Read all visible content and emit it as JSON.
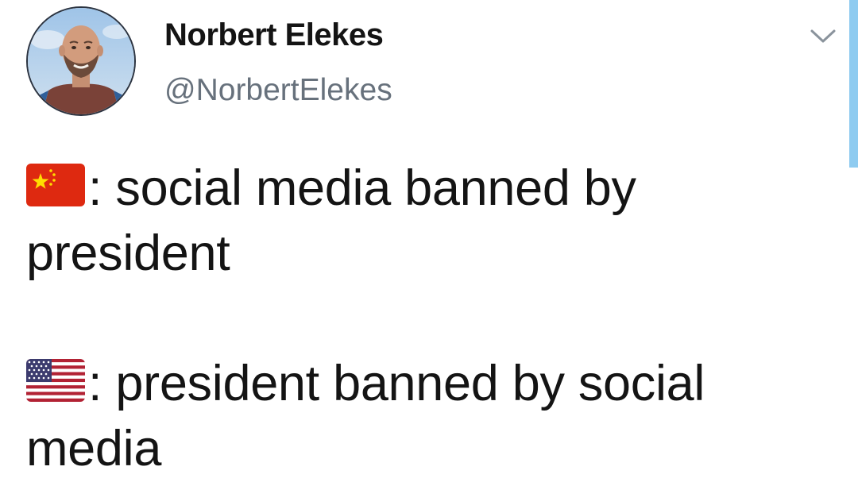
{
  "tweet": {
    "author": {
      "display_name": "Norbert Elekes",
      "handle": "@NorbertElekes",
      "avatar_icon": "profile-photo"
    },
    "menu_icon": "chevron-down-icon",
    "body": [
      {
        "flag_icon": "china-flag-icon",
        "text_part1": ": social media banned by",
        "text_part2": "president"
      },
      {
        "flag_icon": "us-flag-icon",
        "text_part1": ": president banned by social",
        "text_part2": "media"
      }
    ]
  },
  "colors": {
    "text": "#141414",
    "handle": "#67717c",
    "china_red": "#de2910",
    "china_yellow": "#ffde00",
    "us_red": "#b22234",
    "us_blue": "#3c3b6e",
    "scroll_indicator": "#8ecbf0"
  }
}
